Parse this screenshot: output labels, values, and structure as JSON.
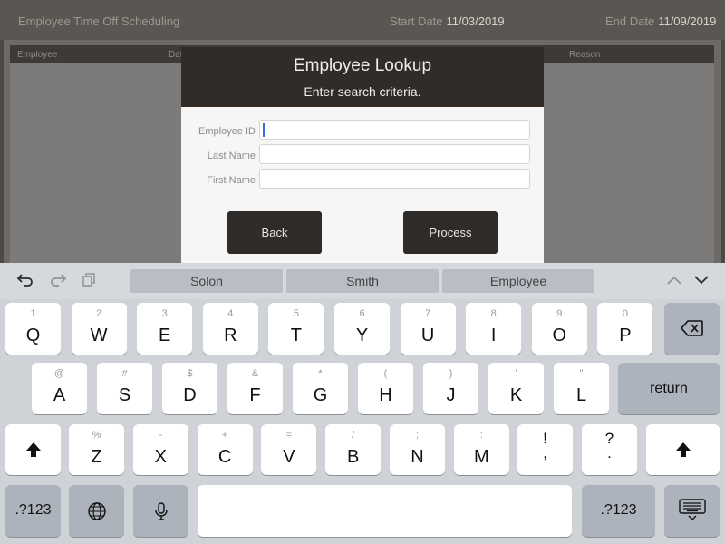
{
  "header": {
    "title": "Employee Time Off Scheduling",
    "start_label": "Start Date",
    "start_value": "11/03/2019",
    "end_label": "End Date",
    "end_value": "11/09/2019"
  },
  "grid": {
    "columns": [
      "Employee",
      "Dat",
      "Reason"
    ]
  },
  "dialog": {
    "title": "Employee Lookup",
    "subtitle": "Enter search criteria.",
    "fields": [
      {
        "label": "Employee ID",
        "value": ""
      },
      {
        "label": "Last Name",
        "value": ""
      },
      {
        "label": "First Name",
        "value": ""
      }
    ],
    "back_label": "Back",
    "process_label": "Process"
  },
  "keyboard": {
    "suggestions": [
      "Solon",
      "Smith",
      "Employee"
    ],
    "row1": [
      {
        "n": "1",
        "l": "Q"
      },
      {
        "n": "2",
        "l": "W"
      },
      {
        "n": "3",
        "l": "E"
      },
      {
        "n": "4",
        "l": "R"
      },
      {
        "n": "5",
        "l": "T"
      },
      {
        "n": "6",
        "l": "Y"
      },
      {
        "n": "7",
        "l": "U"
      },
      {
        "n": "8",
        "l": "I"
      },
      {
        "n": "9",
        "l": "O"
      },
      {
        "n": "0",
        "l": "P"
      }
    ],
    "row2": [
      {
        "n": "@",
        "l": "A"
      },
      {
        "n": "#",
        "l": "S"
      },
      {
        "n": "$",
        "l": "D"
      },
      {
        "n": "&",
        "l": "F"
      },
      {
        "n": "*",
        "l": "G"
      },
      {
        "n": "(",
        "l": "H"
      },
      {
        "n": ")",
        "l": "J"
      },
      {
        "n": "'",
        "l": "K"
      },
      {
        "n": "\"",
        "l": "L"
      }
    ],
    "row3": [
      {
        "n": "%",
        "l": "Z"
      },
      {
        "n": "-",
        "l": "X"
      },
      {
        "n": "+",
        "l": "C"
      },
      {
        "n": "=",
        "l": "V"
      },
      {
        "n": "/",
        "l": "B"
      },
      {
        "n": ";",
        "l": "N"
      },
      {
        "n": ":",
        "l": "M"
      }
    ],
    "punct1": {
      "top": "!",
      "bottom": ","
    },
    "punct2": {
      "top": "?",
      "bottom": "."
    },
    "return_label": "return",
    "numbers_label": ".?123",
    "icons": {
      "undo": "undo-icon",
      "redo": "redo-icon",
      "paste": "paste-icon",
      "up": "chevron-up-icon",
      "down": "chevron-down-icon",
      "delete": "delete-icon",
      "shift": "shift-icon",
      "globe": "globe-icon",
      "mic": "mic-icon",
      "hide": "hide-keyboard-icon"
    }
  }
}
